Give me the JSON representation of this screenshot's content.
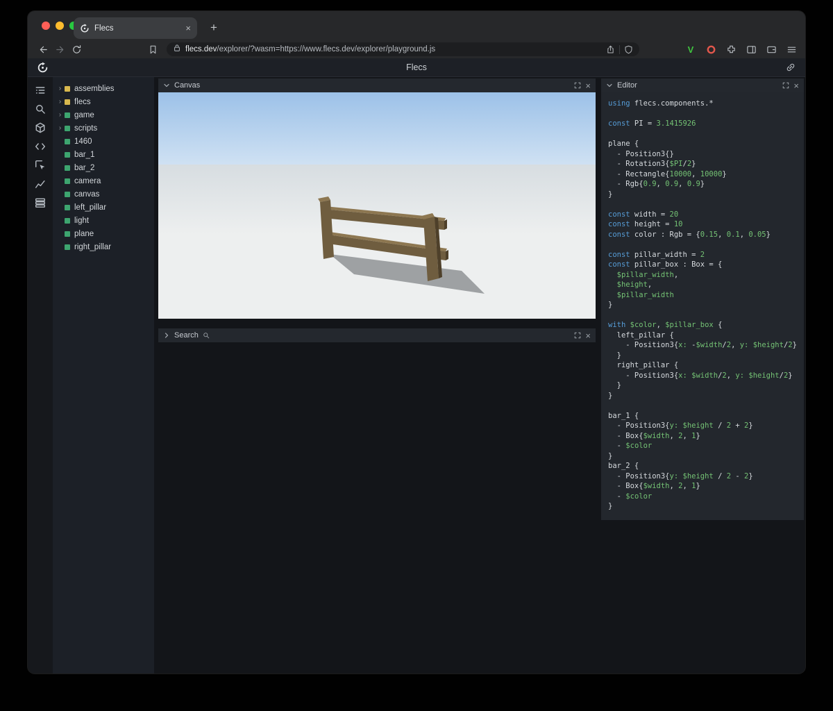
{
  "browser": {
    "tab_title": "Flecs",
    "tab_close": "×",
    "new_tab": "+",
    "url_domain": "flecs.dev",
    "url_rest": "/explorer/?wasm=https://www.flecs.dev/explorer/playground.js",
    "extension_v": "V"
  },
  "app": {
    "title": "Flecs"
  },
  "sidebar": {
    "icons": [
      "outline",
      "search",
      "entities",
      "code",
      "inspect",
      "chart",
      "data"
    ]
  },
  "tree": {
    "expander_glyph": "›",
    "items": [
      {
        "label": "assemblies",
        "kind": "yellow",
        "expand": true
      },
      {
        "label": "flecs",
        "kind": "yellow",
        "expand": true
      },
      {
        "label": "game",
        "kind": "green",
        "expand": true
      },
      {
        "label": "scripts",
        "kind": "green",
        "expand": true
      },
      {
        "label": "1460",
        "kind": "green",
        "expand": false
      },
      {
        "label": "bar_1",
        "kind": "green",
        "expand": false
      },
      {
        "label": "bar_2",
        "kind": "green",
        "expand": false
      },
      {
        "label": "camera",
        "kind": "green",
        "expand": false
      },
      {
        "label": "canvas",
        "kind": "green",
        "expand": false
      },
      {
        "label": "left_pillar",
        "kind": "green",
        "expand": false
      },
      {
        "label": "light",
        "kind": "green",
        "expand": false
      },
      {
        "label": "plane",
        "kind": "green",
        "expand": false
      },
      {
        "label": "right_pillar",
        "kind": "green",
        "expand": false
      }
    ]
  },
  "panels": {
    "canvas": {
      "title": "Canvas"
    },
    "search": {
      "title": "Search"
    },
    "editor": {
      "title": "Editor"
    },
    "close_glyph": "×"
  },
  "colors": {
    "module_yellow": "#d8b84e",
    "entity_green": "#3da56f",
    "keyword_blue": "#569cd6",
    "value_green": "#74c274",
    "code_plain": "#d6dade",
    "traffic_red": "#ff5f57",
    "traffic_yellow": "#febc2e",
    "traffic_green": "#28c840",
    "brave_v_green": "#3fc43f"
  },
  "scene": {
    "sky_top": "#9cc1e8",
    "sky_horizon": "#cfe1f3",
    "ground_far": "#d7dde1",
    "ground_near": "#edefef",
    "wood": "#6f5d3f",
    "wood_light": "#8d7751",
    "wood_dark": "#4e402a",
    "shadow": "rgba(80,83,88,0.5)"
  },
  "code": {
    "lines": [
      [
        [
          "kw",
          "using"
        ],
        [
          "pl",
          " flecs.components.*"
        ]
      ],
      [],
      [
        [
          "kw",
          "const"
        ],
        [
          "pl",
          " PI = "
        ],
        [
          "gr",
          "3.1415926"
        ]
      ],
      [],
      [
        [
          "pl",
          "plane {"
        ]
      ],
      [
        [
          "pl",
          "  - Position3{}"
        ]
      ],
      [
        [
          "pl",
          "  - Rotation3{"
        ],
        [
          "gr",
          "$PI"
        ],
        [
          "pl",
          "/"
        ],
        [
          "gr",
          "2"
        ],
        [
          "pl",
          "}"
        ]
      ],
      [
        [
          "pl",
          "  - Rectangle{"
        ],
        [
          "gr",
          "10000"
        ],
        [
          "pl",
          ", "
        ],
        [
          "gr",
          "10000"
        ],
        [
          "pl",
          "}"
        ]
      ],
      [
        [
          "pl",
          "  - Rgb{"
        ],
        [
          "gr",
          "0.9"
        ],
        [
          "pl",
          ", "
        ],
        [
          "gr",
          "0.9"
        ],
        [
          "pl",
          ", "
        ],
        [
          "gr",
          "0.9"
        ],
        [
          "pl",
          "}"
        ]
      ],
      [
        [
          "pl",
          "}"
        ]
      ],
      [],
      [
        [
          "kw",
          "const"
        ],
        [
          "pl",
          " width = "
        ],
        [
          "gr",
          "20"
        ]
      ],
      [
        [
          "kw",
          "const"
        ],
        [
          "pl",
          " height = "
        ],
        [
          "gr",
          "10"
        ]
      ],
      [
        [
          "kw",
          "const"
        ],
        [
          "pl",
          " color : Rgb = {"
        ],
        [
          "gr",
          "0.15"
        ],
        [
          "pl",
          ", "
        ],
        [
          "gr",
          "0.1"
        ],
        [
          "pl",
          ", "
        ],
        [
          "gr",
          "0.05"
        ],
        [
          "pl",
          "}"
        ]
      ],
      [],
      [
        [
          "kw",
          "const"
        ],
        [
          "pl",
          " pillar_width = "
        ],
        [
          "gr",
          "2"
        ]
      ],
      [
        [
          "kw",
          "const"
        ],
        [
          "pl",
          " pillar_box : Box = {"
        ]
      ],
      [
        [
          "pl",
          "  "
        ],
        [
          "gr",
          "$pillar_width"
        ],
        [
          "pl",
          ","
        ]
      ],
      [
        [
          "pl",
          "  "
        ],
        [
          "gr",
          "$height"
        ],
        [
          "pl",
          ","
        ]
      ],
      [
        [
          "pl",
          "  "
        ],
        [
          "gr",
          "$pillar_width"
        ]
      ],
      [
        [
          "pl",
          "}"
        ]
      ],
      [],
      [
        [
          "kw",
          "with"
        ],
        [
          "pl",
          " "
        ],
        [
          "gr",
          "$color"
        ],
        [
          "pl",
          ", "
        ],
        [
          "gr",
          "$pillar_box"
        ],
        [
          "pl",
          " {"
        ]
      ],
      [
        [
          "pl",
          "  left_pillar {"
        ]
      ],
      [
        [
          "pl",
          "    - Position3{"
        ],
        [
          "gr",
          "x:"
        ],
        [
          "pl",
          " -"
        ],
        [
          "gr",
          "$width"
        ],
        [
          "pl",
          "/"
        ],
        [
          "gr",
          "2"
        ],
        [
          "pl",
          ", "
        ],
        [
          "gr",
          "y:"
        ],
        [
          "pl",
          " "
        ],
        [
          "gr",
          "$height"
        ],
        [
          "pl",
          "/"
        ],
        [
          "gr",
          "2"
        ],
        [
          "pl",
          "}"
        ]
      ],
      [
        [
          "pl",
          "  }"
        ]
      ],
      [
        [
          "pl",
          "  right_pillar {"
        ]
      ],
      [
        [
          "pl",
          "    - Position3{"
        ],
        [
          "gr",
          "x:"
        ],
        [
          "pl",
          " "
        ],
        [
          "gr",
          "$width"
        ],
        [
          "pl",
          "/"
        ],
        [
          "gr",
          "2"
        ],
        [
          "pl",
          ", "
        ],
        [
          "gr",
          "y:"
        ],
        [
          "pl",
          " "
        ],
        [
          "gr",
          "$height"
        ],
        [
          "pl",
          "/"
        ],
        [
          "gr",
          "2"
        ],
        [
          "pl",
          "}"
        ]
      ],
      [
        [
          "pl",
          "  }"
        ]
      ],
      [
        [
          "pl",
          "}"
        ]
      ],
      [],
      [
        [
          "pl",
          "bar_1 {"
        ]
      ],
      [
        [
          "pl",
          "  - Position3{"
        ],
        [
          "gr",
          "y:"
        ],
        [
          "pl",
          " "
        ],
        [
          "gr",
          "$height"
        ],
        [
          "pl",
          " / "
        ],
        [
          "gr",
          "2"
        ],
        [
          "pl",
          " + "
        ],
        [
          "gr",
          "2"
        ],
        [
          "pl",
          "}"
        ]
      ],
      [
        [
          "pl",
          "  - Box{"
        ],
        [
          "gr",
          "$width"
        ],
        [
          "pl",
          ", "
        ],
        [
          "gr",
          "2"
        ],
        [
          "pl",
          ", "
        ],
        [
          "gr",
          "1"
        ],
        [
          "pl",
          "}"
        ]
      ],
      [
        [
          "pl",
          "  - "
        ],
        [
          "gr",
          "$color"
        ]
      ],
      [
        [
          "pl",
          "}"
        ]
      ],
      [
        [
          "pl",
          "bar_2 {"
        ]
      ],
      [
        [
          "pl",
          "  - Position3{"
        ],
        [
          "gr",
          "y:"
        ],
        [
          "pl",
          " "
        ],
        [
          "gr",
          "$height"
        ],
        [
          "pl",
          " / "
        ],
        [
          "gr",
          "2"
        ],
        [
          "pl",
          " - "
        ],
        [
          "gr",
          "2"
        ],
        [
          "pl",
          "}"
        ]
      ],
      [
        [
          "pl",
          "  - Box{"
        ],
        [
          "gr",
          "$width"
        ],
        [
          "pl",
          ", "
        ],
        [
          "gr",
          "2"
        ],
        [
          "pl",
          ", "
        ],
        [
          "gr",
          "1"
        ],
        [
          "pl",
          "}"
        ]
      ],
      [
        [
          "pl",
          "  - "
        ],
        [
          "gr",
          "$color"
        ]
      ],
      [
        [
          "pl",
          "}"
        ]
      ]
    ]
  }
}
